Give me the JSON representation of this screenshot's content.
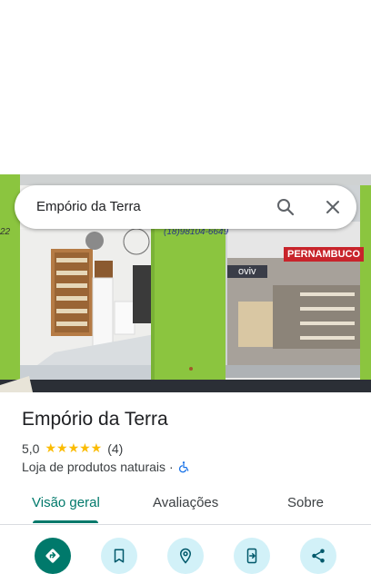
{
  "search": {
    "query": "Empório da Terra"
  },
  "place": {
    "name": "Empório da Terra",
    "rating": "5,0",
    "reviews": "(4)",
    "stars": "★★★★★",
    "category": "Loja de produtos naturais",
    "separator": "·"
  },
  "photo": {
    "sign_left": "22",
    "phone": "(18)98104-6649",
    "store_sign": "PERNAMBUCO",
    "shop_sign": "oviv"
  },
  "tabs": [
    {
      "label": "Visão geral",
      "active": true
    },
    {
      "label": "Avaliações"
    },
    {
      "label": "Sobre"
    }
  ],
  "actions": [
    {
      "icon": "directions-icon"
    },
    {
      "icon": "bookmark-icon"
    },
    {
      "icon": "nearby-icon"
    },
    {
      "icon": "send-to-phone-icon"
    },
    {
      "icon": "share-icon"
    }
  ],
  "colors": {
    "accent": "#00796b",
    "star": "#fbbc04",
    "chip_bg": "#d2f1f8",
    "wall_green": "#8bc53f"
  }
}
